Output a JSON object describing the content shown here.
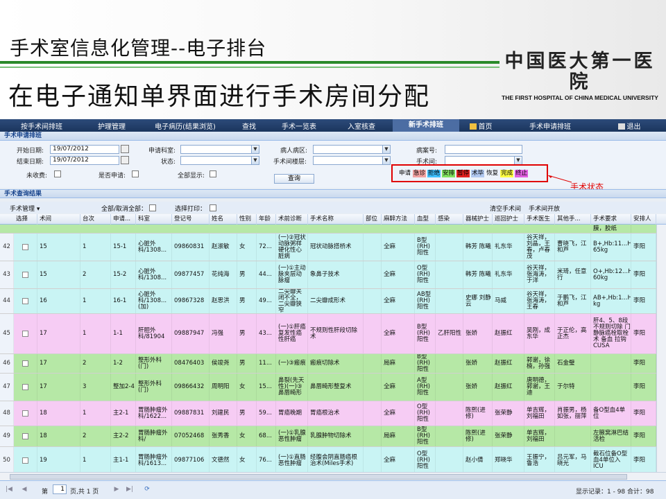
{
  "slide": {
    "title1": "手术室信息化管理--电子排台",
    "title2": "在电子通知单界面进行手术房间分配",
    "logo_cn": "中国医大第一医院",
    "logo_en": "THE FIRST HOSPITAL OF CHINA MEDICAL UNIVERSITY"
  },
  "nav": [
    {
      "label": "按手术间排班"
    },
    {
      "label": "护理管理"
    },
    {
      "label": "电子病历(结果浏览)"
    },
    {
      "label": "查找"
    },
    {
      "label": "手术一览表"
    },
    {
      "label": "入室核查"
    },
    {
      "label": "新手术排班"
    },
    {
      "label": "首页"
    },
    {
      "label": "手术申请排班"
    },
    {
      "label": "退出"
    }
  ],
  "search": {
    "panel_title": "手术申请排班",
    "start_label": "开始日期:",
    "start_value": "19/07/2012",
    "end_label": "结束日期:",
    "end_value": "19/07/2012",
    "dept_label": "申请科室:",
    "status_label": "状态:",
    "ward_label": "病人病区:",
    "floor_label": "手术间楼层:",
    "caseno_label": "病案号:",
    "room_label": "手术间:",
    "unpaid_label": "未收费:",
    "is_apply_label": "是否申请:",
    "show_all_label": "全部显示:",
    "query_button": "查询"
  },
  "legend": {
    "items": [
      {
        "label": "申请",
        "color": "#eef3fa"
      },
      {
        "label": "急诊",
        "color": "#f0a0a0"
      },
      {
        "label": "拒绝",
        "color": "#40c0ff"
      },
      {
        "label": "安排",
        "color": "#80e060"
      },
      {
        "label": "暂停",
        "color": "#e02020"
      },
      {
        "label": "术毕",
        "color": "#b0c8f0"
      },
      {
        "label": "恢复",
        "color": "#eef3fa"
      },
      {
        "label": "完成",
        "color": "#ffff40"
      },
      {
        "label": "终止",
        "color": "#e060e0"
      }
    ],
    "callout": "手术状态"
  },
  "results": {
    "panel_title": "手术查询结果",
    "toolbar_manage": "手术管理 ▾",
    "toolbar_select_all": "全部/取消全部：",
    "toolbar_select_print": "选择打印：",
    "toolbar_clear_room": "清空手术间",
    "toolbar_room_open": "手术间开放"
  },
  "grid": {
    "columns": [
      "选择",
      "术间",
      "台次",
      "申请...",
      "科室",
      "登记号",
      "姓名",
      "性别",
      "年龄",
      "术前诊断",
      "手术名称",
      "部位",
      "麻醉方法",
      "血型",
      "感染",
      "器械护士",
      "巡回护士",
      "手术医生",
      "其他手...",
      "手术要求",
      "安排人"
    ],
    "partial_row": {
      "req": "膜，胶纸",
      "color": "#b6e8a6"
    },
    "rows": [
      {
        "n": "42",
        "room": "15",
        "seq": "1",
        "app": "15-1",
        "dept": "心脏外科/1308...",
        "reg": "09860831",
        "name": "赵淑敏",
        "sex": "女",
        "age": "72...",
        "diag": "(一)②冠状动脉粥样硬化性心脏病",
        "op": "冠状动脉搭桥术",
        "site": "",
        "anes": "全麻",
        "blood": "B型(RH)阳性",
        "inf": "",
        "scrub": "韩芳 陈曦",
        "circ": "礼东华",
        "doc": "谷天祥，刘晶，王春，卢春茂",
        "other": "曹晓飞，江和芦",
        "req": "B+,Hb:11...HCT:34%...W: 65kg",
        "by": "李阳",
        "color": "#c9f4f4"
      },
      {
        "n": "43",
        "room": "15",
        "seq": "2",
        "app": "15-2",
        "dept": "心脏外科/1308...",
        "reg": "09877457",
        "name": "花纯海",
        "sex": "男",
        "age": "44...",
        "diag": "(一)①主动脉夹层动脉瘤",
        "op": "象鼻子技术",
        "site": "",
        "anes": "全麻",
        "blood": "O型(RH)阳性",
        "inf": "",
        "scrub": "韩芳 陈曦",
        "circ": "礼东华",
        "doc": "谷天祥，张海涛，于洋",
        "other": "米琦，任意行",
        "req": "O+,Hb:12...HCT:34%...W: 60kg",
        "by": "李阳",
        "color": "#c9f4f4"
      },
      {
        "n": "44",
        "room": "16",
        "seq": "1",
        "app": "16-1",
        "dept": "心脏外科/1308...(加)",
        "reg": "09867328",
        "name": "赵思洪",
        "sex": "男",
        "age": "49...",
        "diag": "二尖瓣关闭不全，二尖瓣狭窄",
        "op": "二尖瓣成形术",
        "site": "",
        "anes": "全麻",
        "blood": "AB型(RH)阳性",
        "inf": "",
        "scrub": "史娜 刘静云",
        "circ": "马威",
        "doc": "谷天祥，张海涛，王春",
        "other": "于鹏飞，江和芦",
        "req": "AB+,Hb:1...HCT:47%...W: kg",
        "by": "李阳",
        "color": "#c9f4f4"
      },
      {
        "n": "45",
        "room": "17",
        "seq": "1",
        "app": "1-1",
        "dept": "肝胆外科/81904",
        "reg": "09887947",
        "name": "冯强",
        "sex": "男",
        "age": "43...",
        "diag": "(一)①肝癌复发性癌性肝癌",
        "op": "不规则性肝段切除术",
        "site": "",
        "anes": "全麻",
        "blood": "B型(RH)阳性",
        "inf": "乙肝阳性",
        "scrub": "张娇",
        "circ": "赵振红",
        "doc": "吴刚，成东华",
        "other": "于正伦，高正杰",
        "req": "肝4、5、8段不规则切除 门静脉癌栓取栓术 备血 拉钩 CUSA",
        "by": "李阳",
        "color": "#f6ccf4"
      },
      {
        "n": "46",
        "room": "17",
        "seq": "2",
        "app": "1-2",
        "dept": "整形外科(门)",
        "reg": "08476403",
        "name": "侯竣尧",
        "sex": "男",
        "age": "11...",
        "diag": "(一)③瘢痕",
        "op": "瘢痕切除术",
        "site": "",
        "anes": "局麻",
        "blood": "B型(RH)阳性",
        "inf": "",
        "scrub": "张娇",
        "circ": "赵振红",
        "doc": "郭谢，徐楠，孙强",
        "other": "石金璧",
        "req": "",
        "by": "李阳",
        "color": "#b6e8a6"
      },
      {
        "n": "47",
        "room": "17",
        "seq": "3",
        "app": "整加2-4",
        "dept": "整形外科(门)",
        "reg": "09866432",
        "name": "周明阳",
        "sex": "女",
        "age": "15...",
        "diag": "鼻裂(先天性)(一)③鼻唇畸形",
        "op": "鼻唇畸形整复术",
        "site": "",
        "anes": "全麻",
        "blood": "A型(RH)阳性",
        "inf": "",
        "scrub": "张娇",
        "circ": "赵振红",
        "doc": "唐明德，郭谢，王迪",
        "other": "于尔特",
        "req": "",
        "by": "李阳",
        "color": "#b6e8a6"
      },
      {
        "n": "48",
        "room": "18",
        "seq": "1",
        "app": "主2-1",
        "dept": "胃肠肿瘤外科/1622...",
        "reg": "09887831",
        "name": "刘建民",
        "sex": "男",
        "age": "59...",
        "diag": "胃癌晚期",
        "op": "胃癌根治术",
        "site": "",
        "anes": "全麻",
        "blood": "O型(RH)阳性",
        "inf": "",
        "scrub": "陈熙(进修)",
        "circ": "张荣静",
        "doc": "单吉辉，刘福田",
        "other": "肖振男，杨如张，丽萍",
        "req": "备O型血4单位",
        "by": "李阳",
        "color": "#f6ccf4"
      },
      {
        "n": "49",
        "room": "18",
        "seq": "2",
        "app": "主2-2",
        "dept": "胃肠肿瘤外科/",
        "reg": "07052468",
        "name": "张秀香",
        "sex": "女",
        "age": "68...",
        "diag": "(一)①乳腺恶性肿瘤",
        "op": "乳腺肿物切除术",
        "site": "",
        "anes": "局麻",
        "blood": "B型(RH)阳性",
        "inf": "",
        "scrub": "陈熙(进修)",
        "circ": "张荣静",
        "doc": "单吉辉，刘福田",
        "other": "",
        "req": "左腋窝淋巴结活检",
        "by": "李阳",
        "color": "#b6e8a6"
      },
      {
        "n": "50",
        "room": "19",
        "seq": "1",
        "app": "主1-1",
        "dept": "胃肠肿瘤外科/1613...",
        "reg": "09877106",
        "name": "文德然",
        "sex": "女",
        "age": "76...",
        "diag": "(一)①直肠恶性肿瘤",
        "op": "经腹会阴直肠癌根治术(Miles手术)",
        "site": "",
        "anes": "全麻",
        "blood": "O型(RH)阳性",
        "inf": "",
        "scrub": "赵小倩",
        "circ": "郑晓华",
        "doc": "王振宁，鲁浩",
        "other": "吕元军，马晓光",
        "req": "截石位备O型血4单位入ICU",
        "by": "李阳",
        "color": "#c9f4f4"
      }
    ]
  },
  "pager": {
    "page_prefix": "第",
    "page_value": "1",
    "page_suffix": "页,共 1 页",
    "summary": "显示记录：1 - 98  合计：98"
  }
}
